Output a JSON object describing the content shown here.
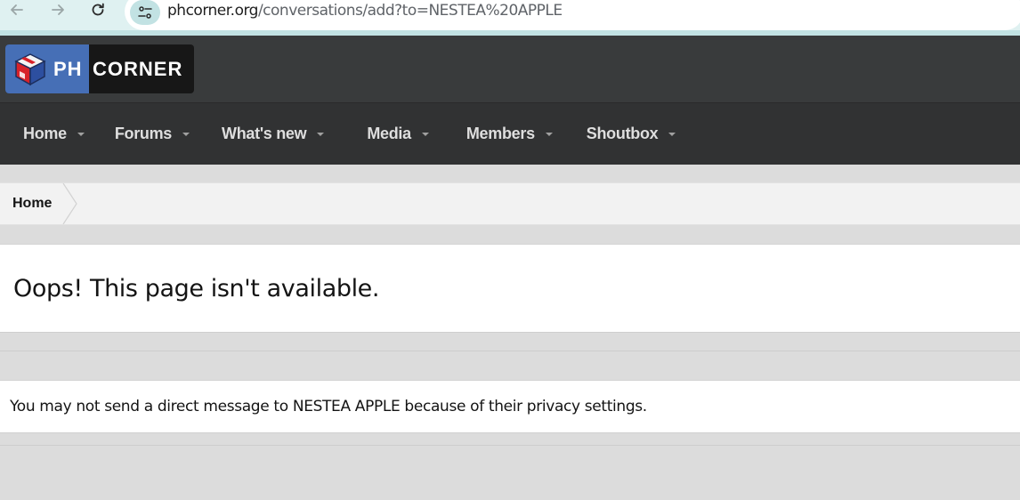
{
  "browser": {
    "url_domain": "phcorner.org",
    "url_path": "/conversations/add?to=NESTEA%20APPLE",
    "icons": [
      "back-arrow-icon",
      "forward-arrow-icon",
      "reload-icon",
      "site-settings-icon"
    ]
  },
  "logo": {
    "part1": "PH",
    "part2": "CORNER",
    "colors": {
      "left": "#466fb6",
      "right": "#171717"
    }
  },
  "nav": {
    "items": [
      {
        "label": "Home"
      },
      {
        "label": "Forums"
      },
      {
        "label": "What's new"
      },
      {
        "label": "Media"
      },
      {
        "label": "Members"
      },
      {
        "label": "Shoutbox"
      }
    ]
  },
  "breadcrumb": {
    "items": [
      {
        "label": "Home"
      }
    ]
  },
  "main": {
    "title": "Oops! This page isn't available.",
    "message": "You may not send a direct message to NESTEA APPLE because of their privacy settings."
  },
  "colors": {
    "header_bg": "#393b3c",
    "nav_bg": "#313233",
    "page_bg": "#dcdcdc",
    "browser_bar_bg": "#dff1f1"
  }
}
